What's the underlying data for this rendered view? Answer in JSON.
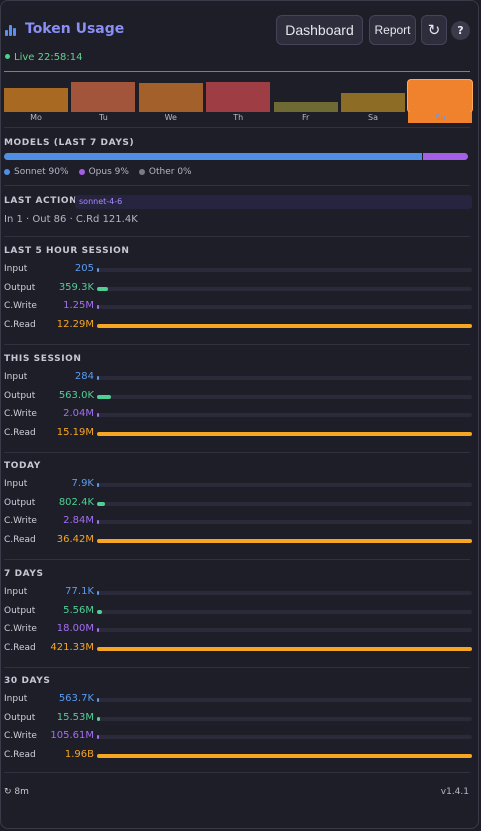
{
  "header": {
    "title": "Token Usage",
    "live_text": "Live 22:58:14",
    "buttons": {
      "dashboard": "Dashboard",
      "report": "Report",
      "refresh": "↻",
      "help": "?"
    }
  },
  "days": [
    {
      "label": "Mo",
      "level": 0.75,
      "color": "#a86a22"
    },
    {
      "label": "Tu",
      "level": 0.95,
      "color": "#a2553a"
    },
    {
      "label": "We",
      "level": 0.9,
      "color": "#a3602a"
    },
    {
      "label": "Th",
      "level": 0.95,
      "color": "#9e3d44"
    },
    {
      "label": "Fr",
      "level": 0.3,
      "color": "#6f6a33"
    },
    {
      "label": "Sa",
      "level": 0.6,
      "color": "#8d6c26"
    },
    {
      "label": "Su",
      "level": 1.0,
      "color": "#f1822d",
      "highlight": true
    }
  ],
  "models": {
    "title": "MODELS (LAST 7 DAYS)",
    "segments": [
      {
        "name": "Sonnet",
        "percent": 90,
        "label": "Sonnet 90%",
        "color": "#4f8fe3"
      },
      {
        "name": "Opus",
        "percent": 9,
        "label": "Opus 9%",
        "color": "#a55fe6"
      },
      {
        "name": "Other",
        "percent": 0,
        "label": "Other 0%",
        "color": "#7b7b86"
      }
    ]
  },
  "last_action": {
    "title": "LAST ACTION",
    "model": "sonnet-4-6",
    "detail": "In 1 · Out 86 · C.Rd 121.4K"
  },
  "labels": {
    "input": "Input",
    "output": "Output",
    "cwrite": "C.Write",
    "cread": "C.Read"
  },
  "colors": {
    "input": "#5a9bf2",
    "output": "#4fcf94",
    "cwrite": "#a36ef2",
    "cread": "#f6a623"
  },
  "sections": [
    {
      "title": "LAST 5 HOUR SESSION",
      "input": {
        "value": "205",
        "fill": 0.002
      },
      "output": {
        "value": "359.3K",
        "fill": 0.028
      },
      "cwrite": {
        "value": "1.25M",
        "fill": 0.004
      },
      "cread": {
        "value": "12.29M",
        "fill": 1.0
      }
    },
    {
      "title": "THIS SESSION",
      "input": {
        "value": "284",
        "fill": 0.002
      },
      "output": {
        "value": "563.0K",
        "fill": 0.037
      },
      "cwrite": {
        "value": "2.04M",
        "fill": 0.004
      },
      "cread": {
        "value": "15.19M",
        "fill": 1.0
      }
    },
    {
      "title": "TODAY",
      "input": {
        "value": "7.9K",
        "fill": 0.002
      },
      "output": {
        "value": "802.4K",
        "fill": 0.022
      },
      "cwrite": {
        "value": "2.84M",
        "fill": 0.004
      },
      "cread": {
        "value": "36.42M",
        "fill": 1.0
      }
    },
    {
      "title": "7 DAYS",
      "input": {
        "value": "77.1K",
        "fill": 0.002
      },
      "output": {
        "value": "5.56M",
        "fill": 0.013
      },
      "cwrite": {
        "value": "18.00M",
        "fill": 0.004
      },
      "cread": {
        "value": "421.33M",
        "fill": 1.0
      }
    },
    {
      "title": "30 DAYS",
      "input": {
        "value": "563.7K",
        "fill": 0.002
      },
      "output": {
        "value": "15.53M",
        "fill": 0.008
      },
      "cwrite": {
        "value": "105.61M",
        "fill": 0.004
      },
      "cread": {
        "value": "1.96B",
        "fill": 1.0
      }
    }
  ],
  "footer": {
    "refresh_icon": "refresh-icon",
    "refresh_text": "↻ 8m",
    "version": "v1.4.1"
  }
}
